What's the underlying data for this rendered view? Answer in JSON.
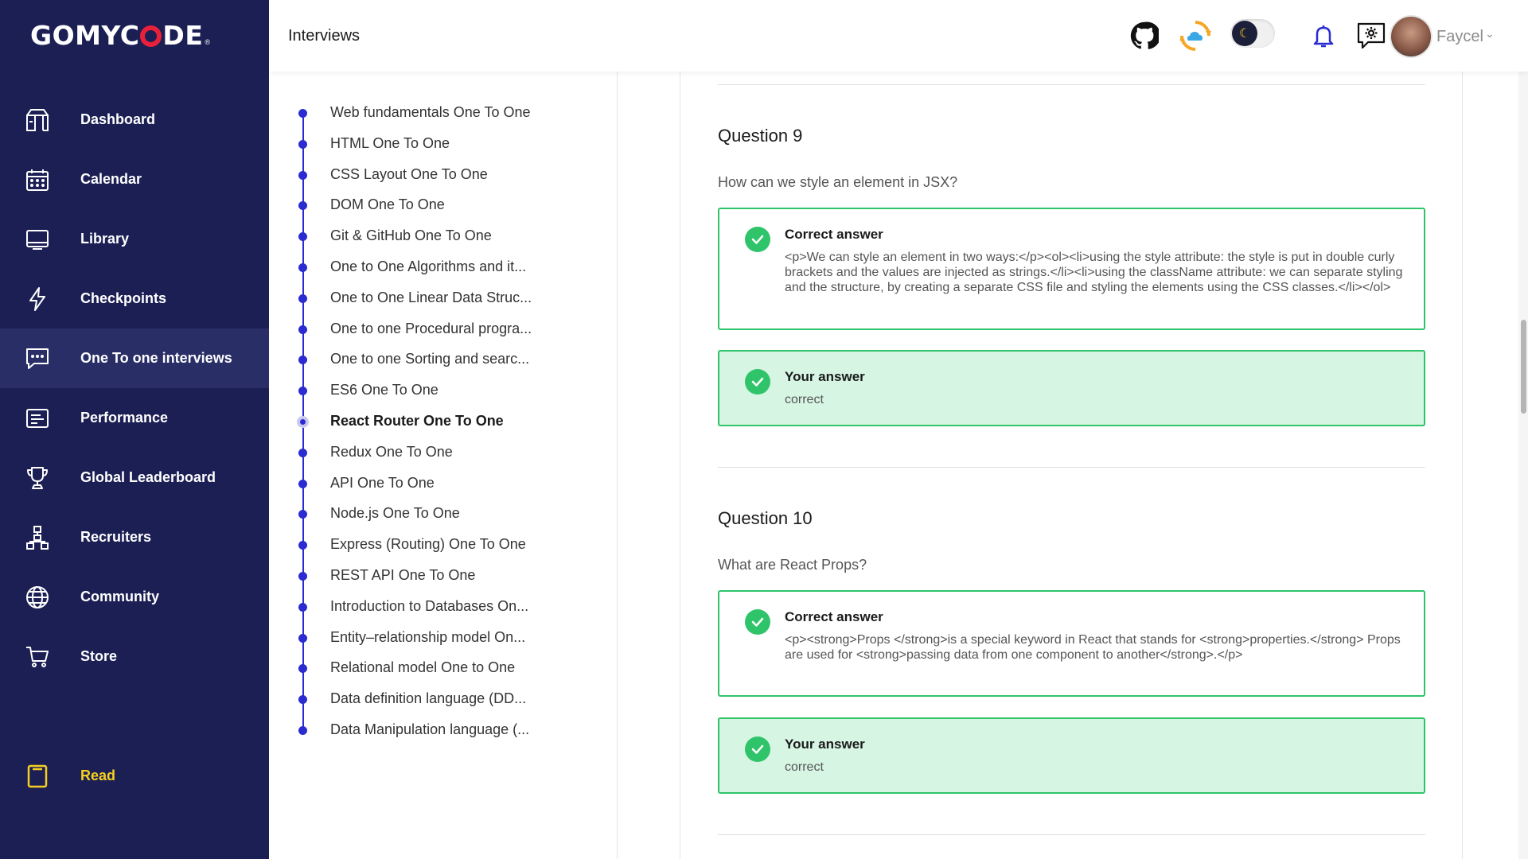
{
  "brand": {
    "logo_pre": "GOMYC",
    "logo_post": "DE",
    "logo_reg": "®"
  },
  "sidebar": {
    "items": [
      {
        "label": "Dashboard",
        "icon": "dashboard-icon"
      },
      {
        "label": "Calendar",
        "icon": "calendar-icon"
      },
      {
        "label": "Library",
        "icon": "library-icon"
      },
      {
        "label": "Checkpoints",
        "icon": "lightning-icon"
      },
      {
        "label": "One To one interviews",
        "icon": "chat-icon",
        "active": true
      },
      {
        "label": "Performance",
        "icon": "performance-icon"
      },
      {
        "label": "Global Leaderboard",
        "icon": "trophy-icon"
      },
      {
        "label": "Recruiters",
        "icon": "org-chart-icon"
      },
      {
        "label": "Community",
        "icon": "globe-icon"
      },
      {
        "label": "Store",
        "icon": "cart-icon"
      }
    ],
    "read_label": "Read"
  },
  "header": {
    "title": "Interviews",
    "username": "Faycel",
    "icons": [
      "github-icon",
      "cloud-sync-icon",
      "dark-mode-toggle",
      "bell-icon",
      "settings-chat-icon",
      "avatar"
    ]
  },
  "timeline": {
    "items": [
      "Web fundamentals One To One",
      "HTML One To One",
      "CSS Layout One To One",
      "DOM One To One",
      "Git & GitHub One To One",
      "One to One Algorithms and it...",
      "One to One Linear Data Struc...",
      "One to one Procedural progra...",
      "One to one Sorting and searc...",
      "ES6 One To One",
      "React Router One To One",
      "Redux One To One",
      "API One To One",
      "Node.js One To One",
      "Express (Routing) One To One",
      "REST API One To One",
      "Introduction to Databases On...",
      "Entity–relationship model On...",
      "Relational model One to One",
      "Data definition language (DD...",
      "Data Manipulation language (..."
    ],
    "active_index": 10
  },
  "questions": [
    {
      "title": "Question 9",
      "text": "How can we style an element in JSX?",
      "correct_label": "Correct answer",
      "correct_text": "<p>We can style an element in two ways:</p><ol><li>using the style attribute: the style is put in double curly brackets and the values are injected as strings.</li><li>using the className attribute: we can separate styling and the structure, by creating a separate CSS file and styling the elements using the CSS classes.</li></ol>",
      "your_label": "Your answer",
      "your_text": "correct"
    },
    {
      "title": "Question 10",
      "text": "What are React Props?",
      "correct_label": "Correct answer",
      "correct_text": "<p><strong>Props </strong>is a special keyword in React that stands for <strong>properties.</strong> Props are used for <strong>passing data from one component to another</strong>.</p>",
      "your_label": "Your answer",
      "your_text": "correct"
    }
  ],
  "colors": {
    "sidebar_bg": "#1c1f54",
    "accent_blue": "#2a2bd0",
    "success_green": "#2fc46a",
    "success_bg": "#d6f5e3",
    "read_yellow": "#f5d020"
  }
}
